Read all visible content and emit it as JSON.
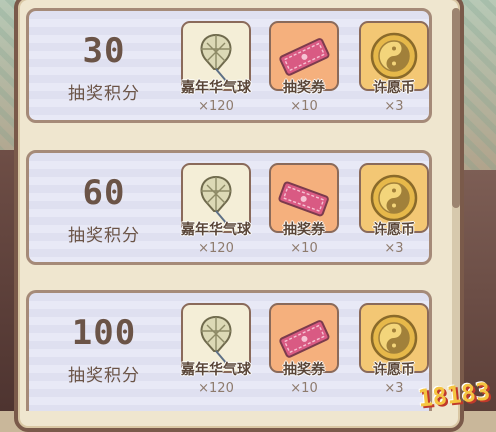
{
  "tiers": [
    {
      "points": "30",
      "points_label": "抽奖积分",
      "rewards": [
        {
          "name": "嘉年华气球",
          "qty": "×120",
          "icon": "balloon-icon"
        },
        {
          "name": "抽奖券",
          "qty": "×10",
          "icon": "ticket-icon"
        },
        {
          "name": "许愿币",
          "qty": "×3",
          "icon": "coin-icon"
        }
      ]
    },
    {
      "points": "60",
      "points_label": "抽奖积分",
      "rewards": [
        {
          "name": "嘉年华气球",
          "qty": "×120",
          "icon": "balloon-icon"
        },
        {
          "name": "抽奖券",
          "qty": "×10",
          "icon": "ticket-icon"
        },
        {
          "name": "许愿币",
          "qty": "×3",
          "icon": "coin-icon"
        }
      ]
    },
    {
      "points": "100",
      "points_label": "抽奖积分",
      "rewards": [
        {
          "name": "嘉年华气球",
          "qty": "×120",
          "icon": "balloon-icon"
        },
        {
          "name": "抽奖券",
          "qty": "×10",
          "icon": "ticket-icon"
        },
        {
          "name": "许愿币",
          "qty": "×3",
          "icon": "coin-icon"
        }
      ]
    }
  ],
  "watermark": "18183",
  "colors": {
    "panel_bg": "#efe6cf",
    "tier_bg": "#dfe0f0",
    "balloon_card": "#f4eed7",
    "ticket_card": "#f5b07d",
    "coin_card": "#f3c774",
    "text_dark": "#6b5447"
  }
}
